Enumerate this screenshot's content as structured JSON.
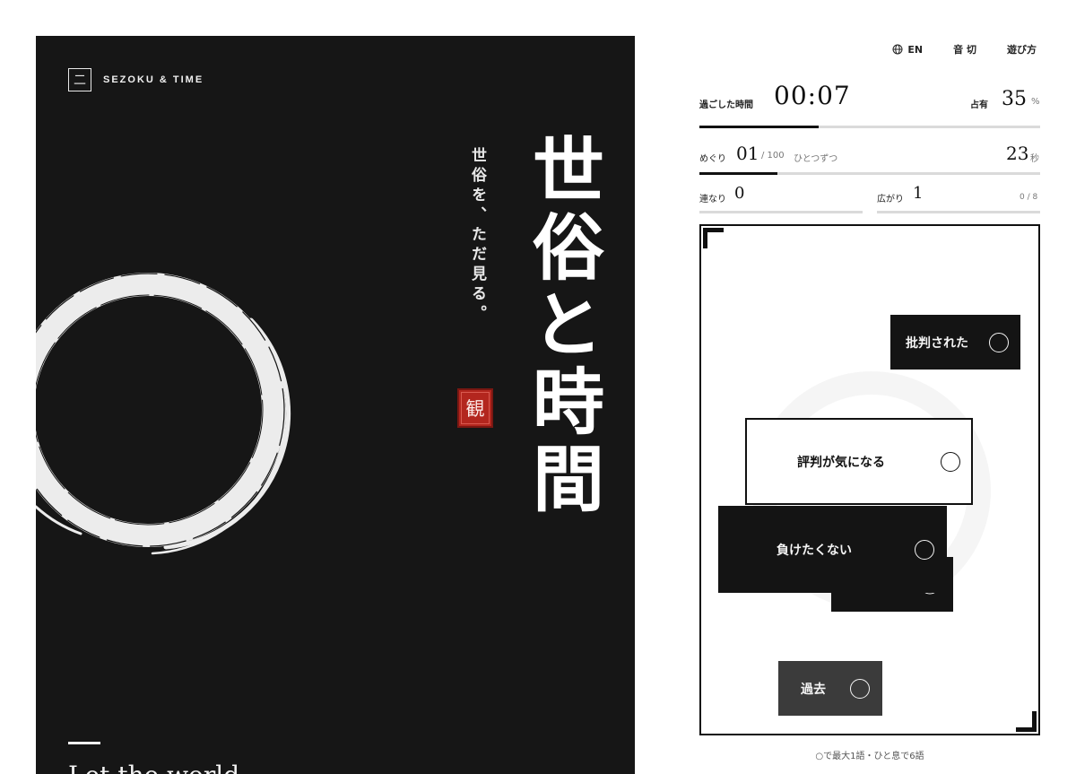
{
  "panel": {
    "logo_mark": "二",
    "brand": "SEZOKU & TIME",
    "title": "世俗と時間",
    "subtitle": "世俗を、ただ見る。",
    "seal": "観",
    "bottom_text": "Let the world"
  },
  "nav": {
    "language": "EN",
    "sound": "音 切",
    "help": "遊び方"
  },
  "stats": {
    "elapsed_label": "過ごした時間",
    "elapsed_value": "00:07",
    "share_label": "占有",
    "share_value": "35",
    "share_unit": "%",
    "share_progress": 0.35,
    "round_label": "めぐり",
    "round_value": "01",
    "round_total": "/ 100",
    "round_mode": "ひとつずつ",
    "round_progress": 0.23,
    "countdown_value": "23",
    "countdown_unit": "秒",
    "chain_label": "連なり",
    "chain_value": "0",
    "spread_label": "広がり",
    "spread_value": "1",
    "spread_ratio": "0 / 8"
  },
  "cards": [
    {
      "text": "批判された",
      "style": "dark"
    },
    {
      "text": "評判が気になる",
      "style": "light"
    },
    {
      "text": "負けたくない",
      "style": "dark"
    },
    {
      "text": "",
      "style": "dark"
    },
    {
      "text": "過去",
      "style": "grey"
    }
  ],
  "hint": "○で最大1語・ひと息で6語",
  "colors": {
    "panel_bg": "#161616",
    "seal_red": "#b3261e",
    "ink": "#111111"
  }
}
